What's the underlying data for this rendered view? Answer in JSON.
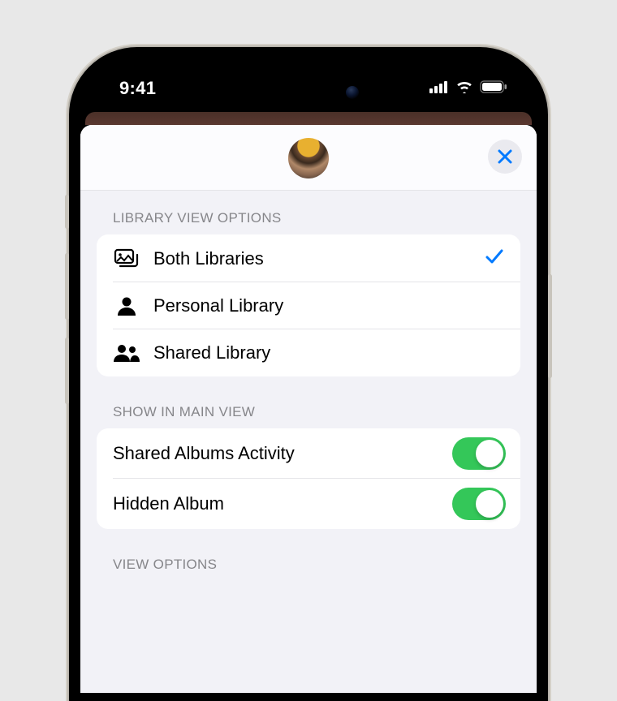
{
  "statusBar": {
    "time": "9:41"
  },
  "sections": {
    "libraryView": {
      "header": "LIBRARY VIEW OPTIONS",
      "items": [
        {
          "label": "Both Libraries",
          "selected": true
        },
        {
          "label": "Personal Library",
          "selected": false
        },
        {
          "label": "Shared Library",
          "selected": false
        }
      ]
    },
    "showInMain": {
      "header": "SHOW IN MAIN VIEW",
      "items": [
        {
          "label": "Shared Albums Activity",
          "on": true
        },
        {
          "label": "Hidden Album",
          "on": true
        }
      ]
    },
    "viewOptions": {
      "header": "VIEW OPTIONS"
    }
  },
  "colors": {
    "accent": "#007aff",
    "toggleOn": "#34c759"
  }
}
